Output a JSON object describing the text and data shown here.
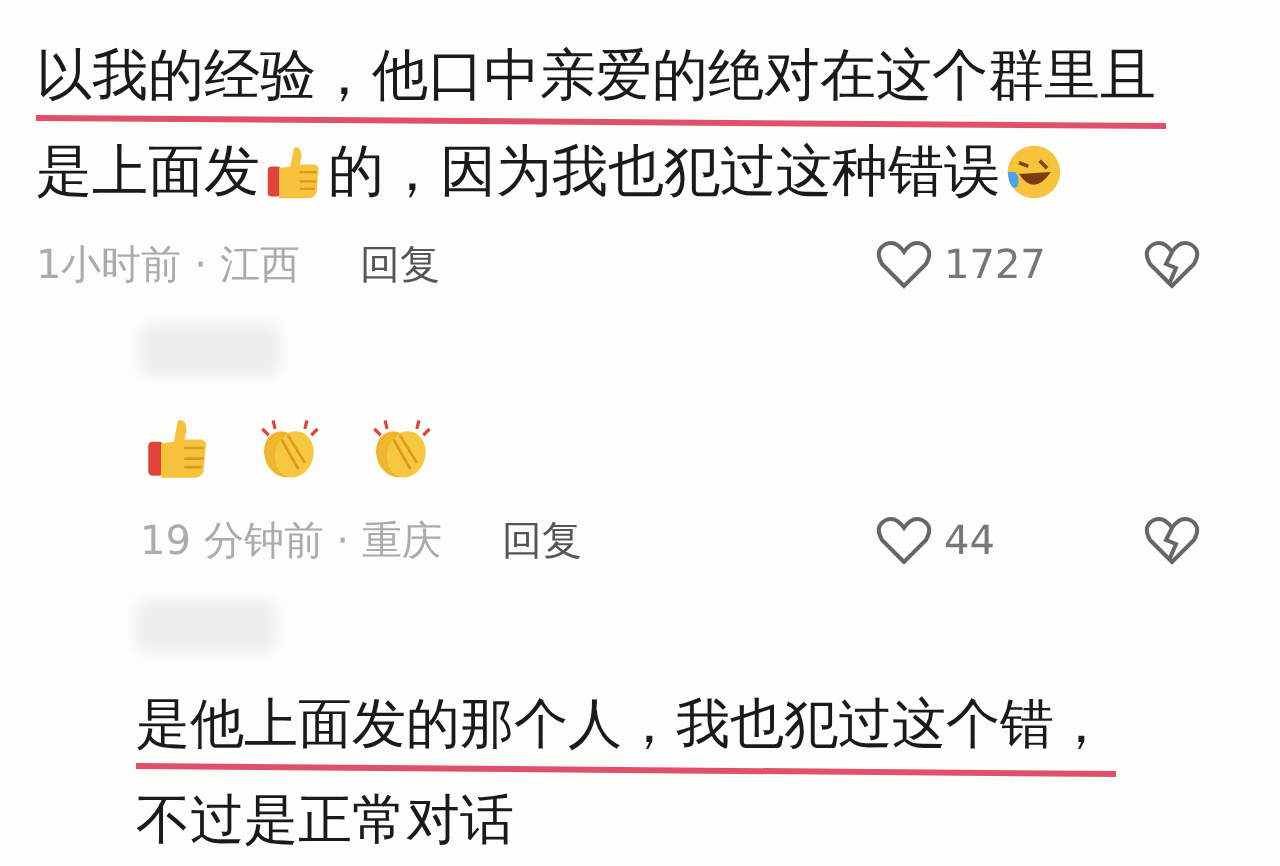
{
  "comments": [
    {
      "lines": [
        {
          "underlined": true,
          "segments": [
            {
              "kind": "text",
              "text": "以我的经验，他口中亲爱的绝对在这个群里且"
            }
          ]
        },
        {
          "underlined": false,
          "segments": [
            {
              "kind": "text",
              "text": "是上面发"
            },
            {
              "kind": "thumb"
            },
            {
              "kind": "text",
              "text": "的，因为我也犯过这种错误"
            },
            {
              "kind": "laugh"
            }
          ]
        }
      ],
      "time": "1小时前 · 江西",
      "reply": "回复",
      "likes": "1727"
    },
    {
      "name_hidden": true,
      "lines": [
        {
          "underlined": false,
          "segments": [
            {
              "kind": "thumb"
            },
            {
              "kind": "clap"
            },
            {
              "kind": "clap"
            }
          ]
        }
      ],
      "time": "19 分钟前 · 重庆",
      "reply": "回复",
      "likes": "44"
    },
    {
      "name_hidden": true,
      "lines": [
        {
          "underlined": true,
          "segments": [
            {
              "kind": "text",
              "text": "是他上面发的那个人，我也犯过这个错，"
            }
          ]
        },
        {
          "underlined": false,
          "segments": [
            {
              "kind": "text",
              "text": "不过是正常对话"
            }
          ]
        }
      ]
    }
  ]
}
